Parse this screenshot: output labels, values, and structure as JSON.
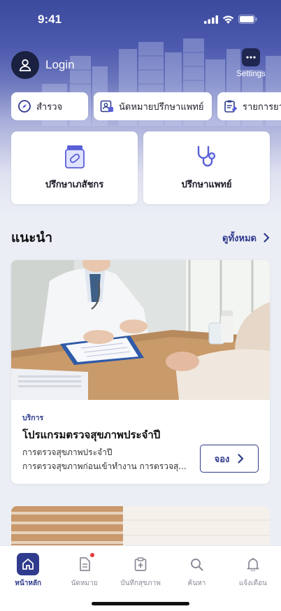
{
  "status": {
    "time": "9:41"
  },
  "header": {
    "login_label": "Login",
    "settings_label": "Settings"
  },
  "chips": [
    {
      "label": "สำรวจ",
      "icon": "compass-icon"
    },
    {
      "label": "นัดหมายปรึกษาแพทย์",
      "icon": "appointment-icon"
    },
    {
      "label": "รายการยา",
      "icon": "medicine-list-icon"
    }
  ],
  "services": [
    {
      "label": "ปรึกษาเภสัชกร",
      "icon": "pill-bottle-icon"
    },
    {
      "label": "ปรึกษาแพทย์",
      "icon": "stethoscope-icon"
    }
  ],
  "recommended": {
    "title": "แนะนำ",
    "see_all": "ดูทั้งหมด",
    "card": {
      "tag": "บริการ",
      "title": "โปรแกรมตรวจสุขภาพประจำปี",
      "desc_line1": "การตรวจสุขภาพประจำปี",
      "desc_line2": "การตรวจสุขภาพก่อนเข้าทำงาน การตรวจสุ...",
      "button": "จอง"
    }
  },
  "tabbar": [
    {
      "label": "หน้าหลัก",
      "icon": "home-icon",
      "active": true
    },
    {
      "label": "นัดหมาย",
      "icon": "document-icon",
      "badge": true
    },
    {
      "label": "บันทึกสุขภาพ",
      "icon": "health-record-icon"
    },
    {
      "label": "ค้นหา",
      "icon": "search-icon"
    },
    {
      "label": "แจ้งเตือน",
      "icon": "bell-icon"
    }
  ],
  "colors": {
    "primary": "#2e3a8c",
    "accent_icon": "#5a5fd8",
    "badge": "#e53935"
  }
}
